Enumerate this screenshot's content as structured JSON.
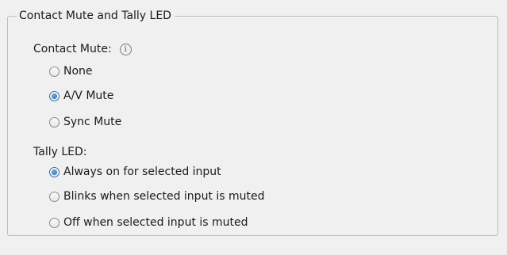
{
  "group": {
    "title": "Contact Mute and Tally LED"
  },
  "contact_mute": {
    "label": "Contact Mute:",
    "info_icon": "info-icon",
    "options": [
      {
        "label": "None",
        "selected": false
      },
      {
        "label": "A/V Mute",
        "selected": true
      },
      {
        "label": "Sync Mute",
        "selected": false
      }
    ]
  },
  "tally_led": {
    "label": "Tally LED:",
    "options": [
      {
        "label": "Always on for selected input",
        "selected": true
      },
      {
        "label": "Blinks when selected input is muted",
        "selected": false
      },
      {
        "label": "Off when selected input is muted",
        "selected": false
      }
    ]
  }
}
